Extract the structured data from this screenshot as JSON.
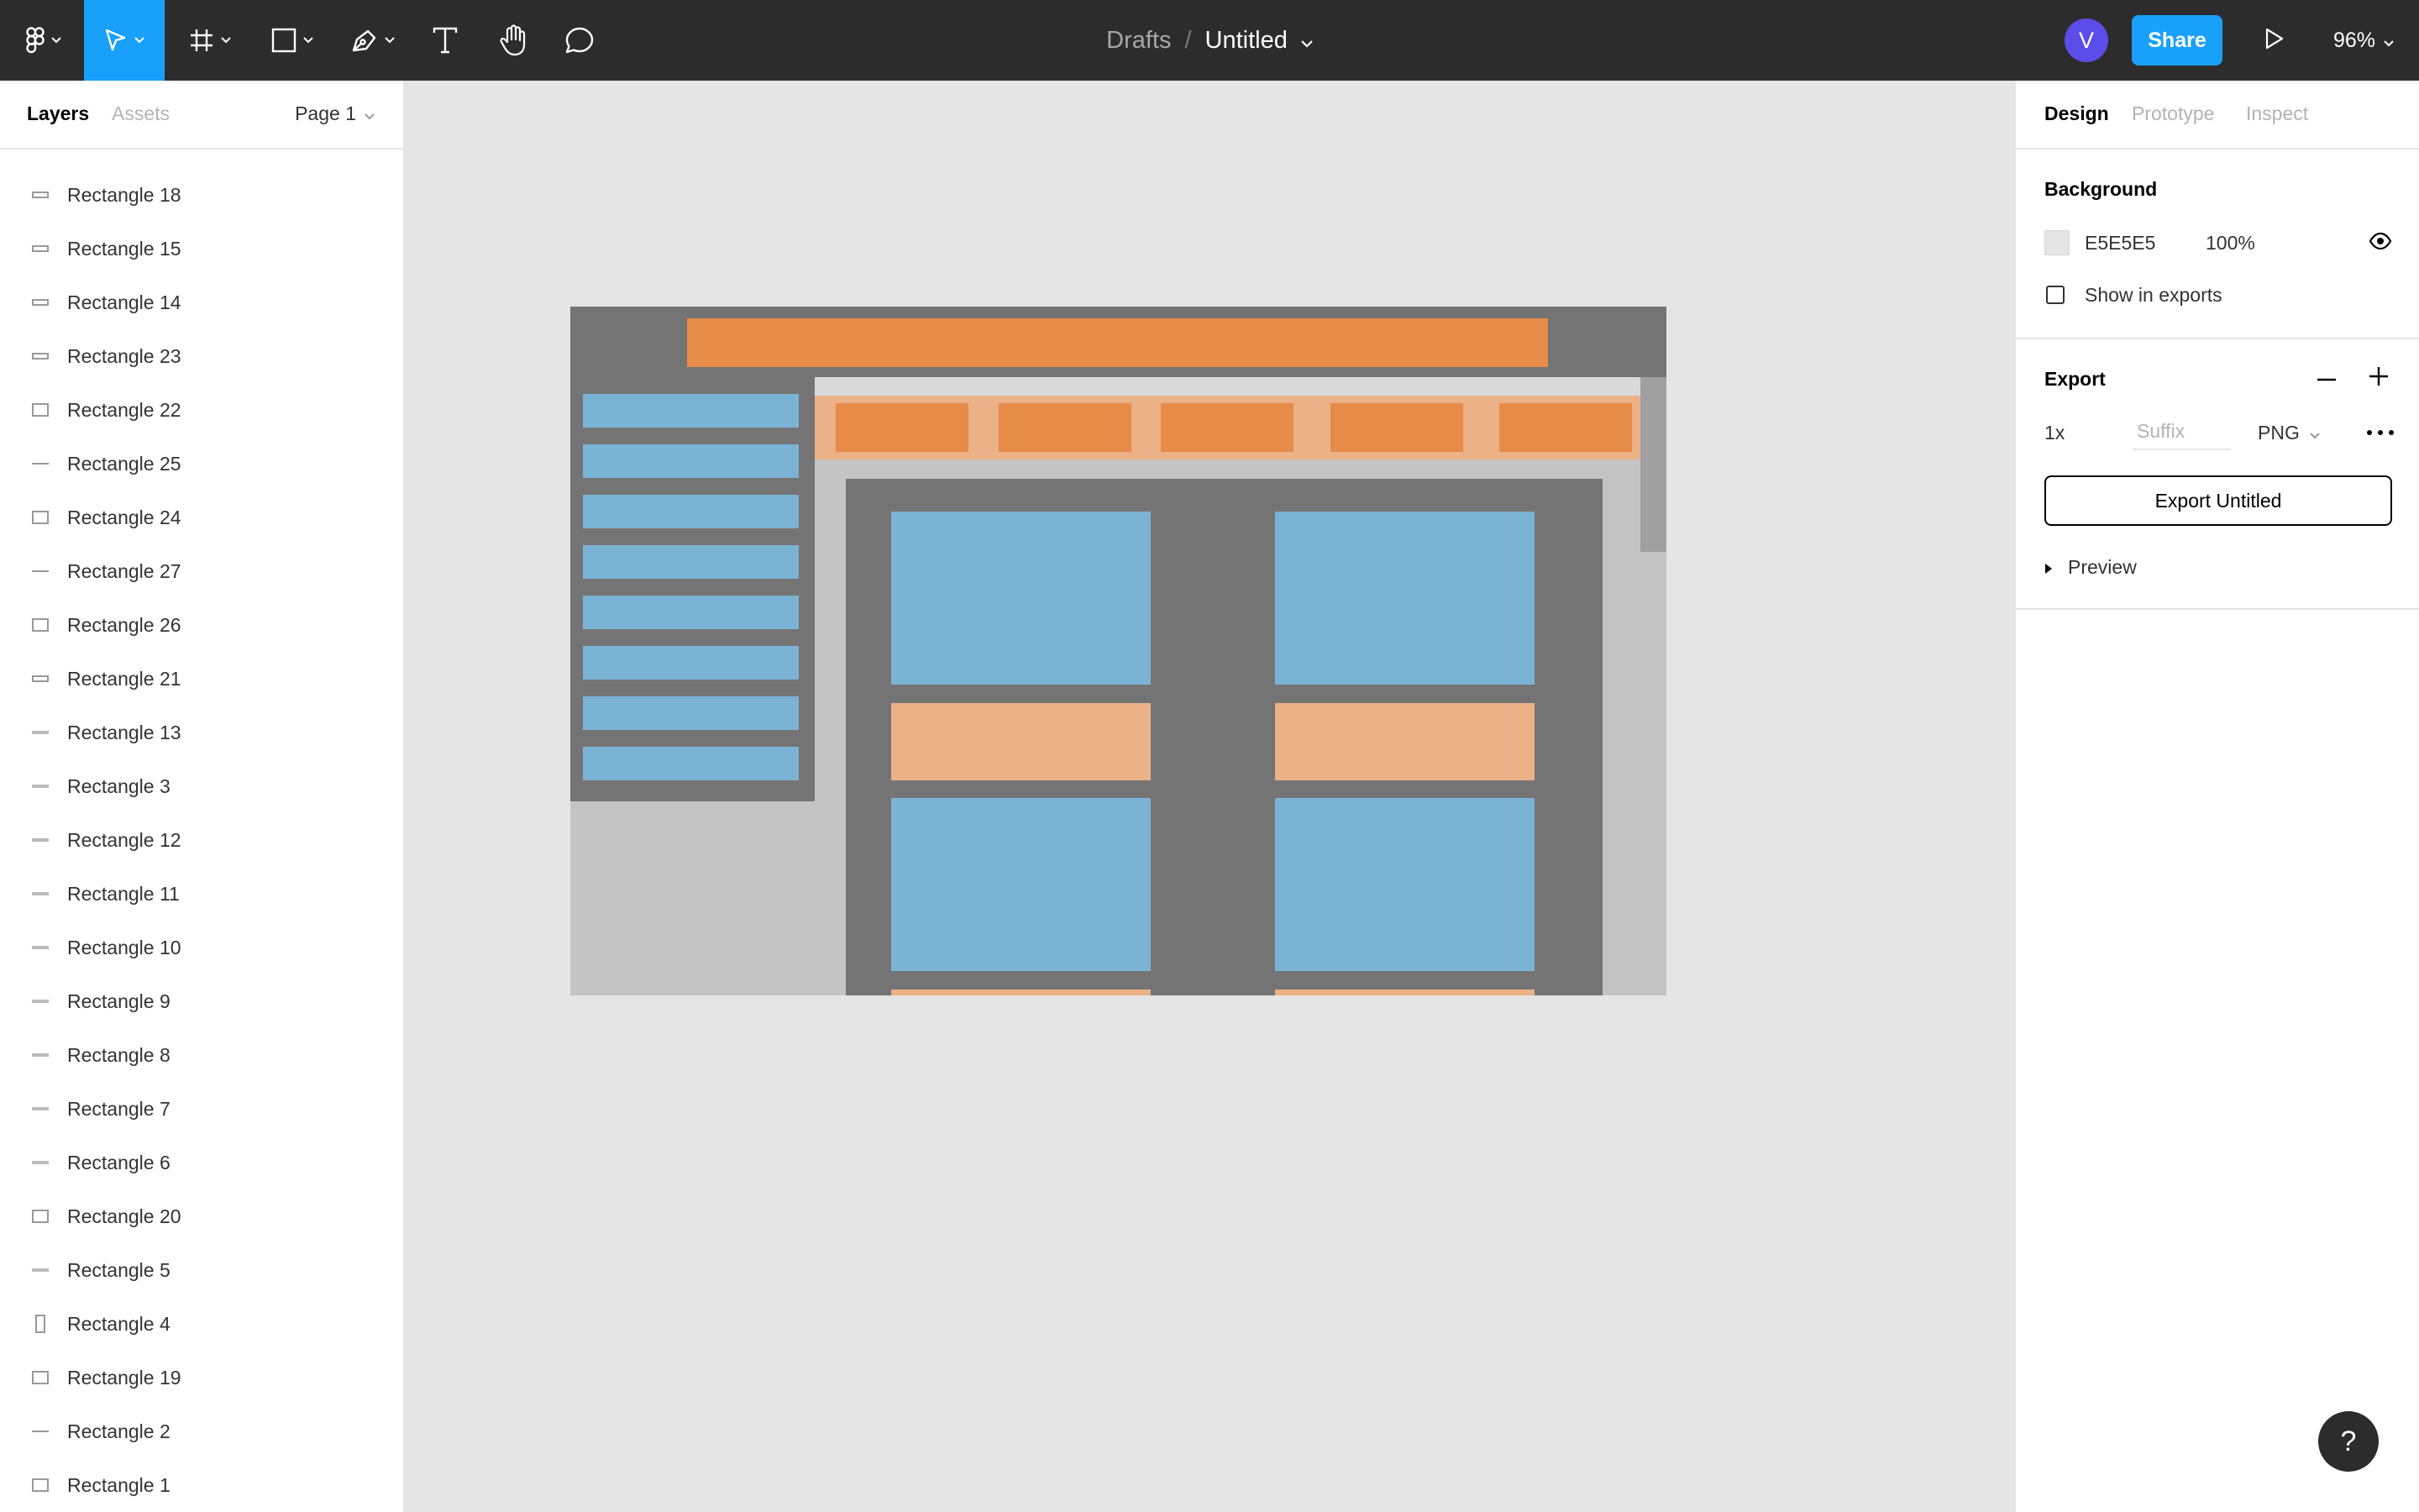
{
  "toolbar": {
    "breadcrumb": {
      "folder": "Drafts",
      "separator": "/",
      "file": "Untitled"
    },
    "avatar_initial": "V",
    "share_label": "Share",
    "zoom": "96%",
    "tools": [
      "figma-menu-icon",
      "move-icon",
      "frame-icon",
      "rectangle-icon",
      "pen-icon",
      "text-icon",
      "hand-icon",
      "comment-icon"
    ],
    "active_tool": "move-icon"
  },
  "left_panel": {
    "tabs": {
      "layers": "Layers",
      "assets": "Assets"
    },
    "page": "Page 1",
    "layers": [
      {
        "name": "Rectangle 18",
        "icon": "thin-rect"
      },
      {
        "name": "Rectangle 15",
        "icon": "thin-rect"
      },
      {
        "name": "Rectangle 14",
        "icon": "thin-rect"
      },
      {
        "name": "Rectangle 23",
        "icon": "thin-rect"
      },
      {
        "name": "Rectangle 22",
        "icon": "rect"
      },
      {
        "name": "Rectangle 25",
        "icon": "line"
      },
      {
        "name": "Rectangle 24",
        "icon": "rect"
      },
      {
        "name": "Rectangle 27",
        "icon": "line"
      },
      {
        "name": "Rectangle 26",
        "icon": "rect"
      },
      {
        "name": "Rectangle 21",
        "icon": "thin-rect"
      },
      {
        "name": "Rectangle 13",
        "icon": "bar"
      },
      {
        "name": "Rectangle 3",
        "icon": "bar"
      },
      {
        "name": "Rectangle 12",
        "icon": "bar"
      },
      {
        "name": "Rectangle 11",
        "icon": "bar"
      },
      {
        "name": "Rectangle 10",
        "icon": "bar"
      },
      {
        "name": "Rectangle 9",
        "icon": "bar"
      },
      {
        "name": "Rectangle 8",
        "icon": "bar"
      },
      {
        "name": "Rectangle 7",
        "icon": "bar"
      },
      {
        "name": "Rectangle 6",
        "icon": "bar"
      },
      {
        "name": "Rectangle 20",
        "icon": "rect"
      },
      {
        "name": "Rectangle 5",
        "icon": "bar"
      },
      {
        "name": "Rectangle 4",
        "icon": "tall-rect"
      },
      {
        "name": "Rectangle 19",
        "icon": "rect"
      },
      {
        "name": "Rectangle 2",
        "icon": "line"
      },
      {
        "name": "Rectangle 1",
        "icon": "rect"
      }
    ]
  },
  "canvas": {
    "colors": {
      "frame_bg": "#c4c4c4",
      "dark": "#747474",
      "orange": "#e78b48",
      "peach": "#ebb187",
      "blue": "#7bb3d4",
      "light": "#d9d9d9",
      "scroll": "#a0a0a0"
    }
  },
  "right_panel": {
    "tabs": {
      "design": "Design",
      "prototype": "Prototype",
      "inspect": "Inspect"
    },
    "background": {
      "title": "Background",
      "hex": "E5E5E5",
      "opacity": "100%",
      "show_in_exports": "Show in exports",
      "show_in_exports_checked": false
    },
    "export": {
      "title": "Export",
      "scale": "1x",
      "suffix_placeholder": "Suffix",
      "format": "PNG",
      "button": "Export Untitled",
      "preview": "Preview"
    }
  },
  "help_label": "?"
}
